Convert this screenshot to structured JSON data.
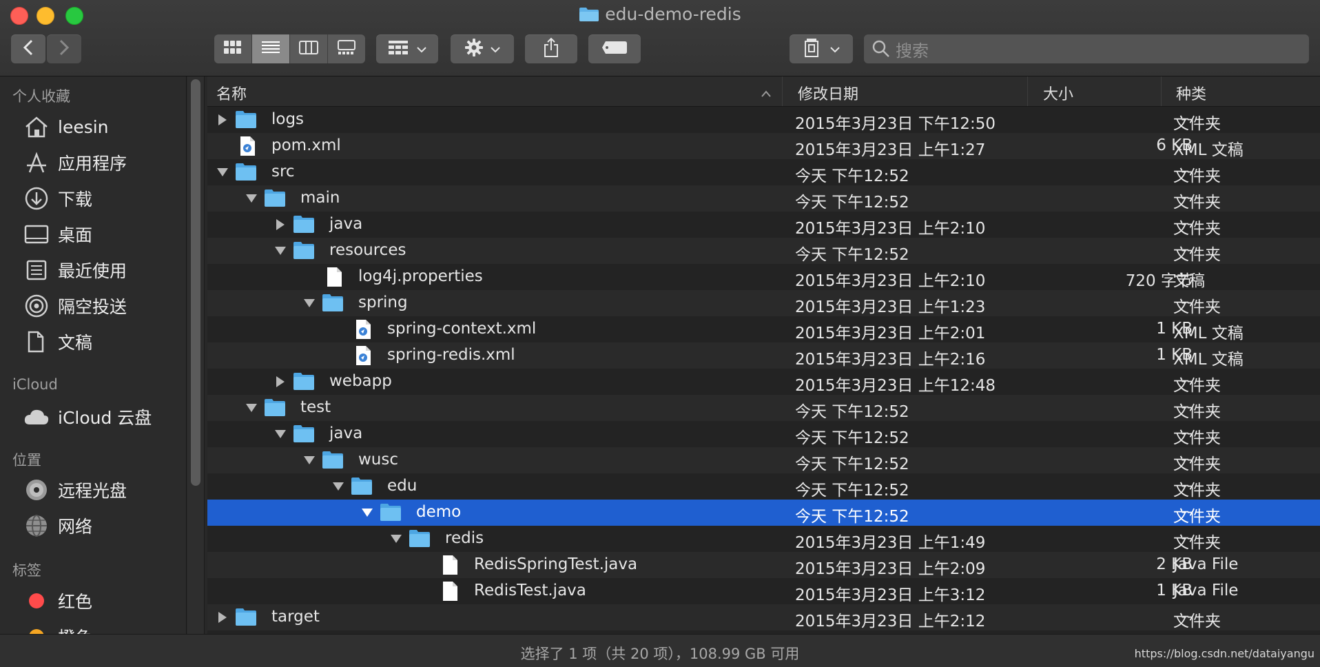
{
  "window": {
    "title": "edu-demo-redis"
  },
  "search": {
    "placeholder": "搜索"
  },
  "sidebar": {
    "sections": [
      {
        "label": "个人收藏"
      },
      {
        "label": "iCloud"
      },
      {
        "label": "位置"
      },
      {
        "label": "标签"
      }
    ],
    "favorites": [
      {
        "label": "leesin",
        "icon": "home-icon"
      },
      {
        "label": "应用程序",
        "icon": "applications-icon"
      },
      {
        "label": "下载",
        "icon": "download-icon"
      },
      {
        "label": "桌面",
        "icon": "desktop-icon"
      },
      {
        "label": "最近使用",
        "icon": "recents-icon"
      },
      {
        "label": "隔空投送",
        "icon": "airdrop-icon"
      },
      {
        "label": "文稿",
        "icon": "documents-icon"
      }
    ],
    "icloud": [
      {
        "label": "iCloud 云盘",
        "icon": "cloud-icon"
      }
    ],
    "locations": [
      {
        "label": "远程光盘",
        "icon": "disc-icon"
      },
      {
        "label": "网络",
        "icon": "network-icon"
      }
    ],
    "tags": [
      {
        "label": "红色",
        "color": "#ff4b4b"
      },
      {
        "label": "橙色",
        "color": "#f5a623"
      }
    ]
  },
  "columns": {
    "name": "名称",
    "date": "修改日期",
    "size": "大小",
    "kind": "种类"
  },
  "files": [
    {
      "name": "logs",
      "date": "2015年3月23日 下午12:50",
      "size": "--",
      "kind": "文件夹",
      "type": "folder",
      "disclosure": "collapsed",
      "depth": 0
    },
    {
      "name": "pom.xml",
      "date": "2015年3月23日 上午1:27",
      "size": "6 KB",
      "kind": "XML 文稿",
      "type": "xml",
      "disclosure": "none",
      "depth": 0
    },
    {
      "name": "src",
      "date": "今天 下午12:52",
      "size": "--",
      "kind": "文件夹",
      "type": "folder",
      "disclosure": "expanded",
      "depth": 0
    },
    {
      "name": "main",
      "date": "今天 下午12:52",
      "size": "--",
      "kind": "文件夹",
      "type": "folder",
      "disclosure": "expanded",
      "depth": 1
    },
    {
      "name": "java",
      "date": "2015年3月23日 上午2:10",
      "size": "--",
      "kind": "文件夹",
      "type": "folder",
      "disclosure": "collapsed",
      "depth": 2
    },
    {
      "name": "resources",
      "date": "今天 下午12:52",
      "size": "--",
      "kind": "文件夹",
      "type": "folder",
      "disclosure": "expanded",
      "depth": 2
    },
    {
      "name": "log4j.properties",
      "date": "2015年3月23日 上午2:10",
      "size": "720 字节",
      "kind": "文稿",
      "type": "file",
      "disclosure": "none",
      "depth": 3
    },
    {
      "name": "spring",
      "date": "2015年3月23日 上午1:23",
      "size": "--",
      "kind": "文件夹",
      "type": "folder",
      "disclosure": "expanded",
      "depth": 3
    },
    {
      "name": "spring-context.xml",
      "date": "2015年3月23日 上午2:01",
      "size": "1 KB",
      "kind": "XML 文稿",
      "type": "xml",
      "disclosure": "none",
      "depth": 4
    },
    {
      "name": "spring-redis.xml",
      "date": "2015年3月23日 上午2:16",
      "size": "1 KB",
      "kind": "XML 文稿",
      "type": "xml",
      "disclosure": "none",
      "depth": 4
    },
    {
      "name": "webapp",
      "date": "2015年3月23日 上午12:48",
      "size": "--",
      "kind": "文件夹",
      "type": "folder",
      "disclosure": "collapsed",
      "depth": 2
    },
    {
      "name": "test",
      "date": "今天 下午12:52",
      "size": "--",
      "kind": "文件夹",
      "type": "folder",
      "disclosure": "expanded",
      "depth": 1
    },
    {
      "name": "java",
      "date": "今天 下午12:52",
      "size": "--",
      "kind": "文件夹",
      "type": "folder",
      "disclosure": "expanded",
      "depth": 2
    },
    {
      "name": "wusc",
      "date": "今天 下午12:52",
      "size": "--",
      "kind": "文件夹",
      "type": "folder",
      "disclosure": "expanded",
      "depth": 3
    },
    {
      "name": "edu",
      "date": "今天 下午12:52",
      "size": "--",
      "kind": "文件夹",
      "type": "folder",
      "disclosure": "expanded",
      "depth": 4
    },
    {
      "name": "demo",
      "date": "今天 下午12:52",
      "size": "--",
      "kind": "文件夹",
      "type": "folder",
      "disclosure": "expanded",
      "depth": 5,
      "selected": true
    },
    {
      "name": "redis",
      "date": "2015年3月23日 上午1:49",
      "size": "--",
      "kind": "文件夹",
      "type": "folder",
      "disclosure": "expanded",
      "depth": 6
    },
    {
      "name": "RedisSpringTest.java",
      "date": "2015年3月23日 上午2:09",
      "size": "2 KB",
      "kind": "Java File",
      "type": "file",
      "disclosure": "none",
      "depth": 7
    },
    {
      "name": "RedisTest.java",
      "date": "2015年3月23日 上午3:12",
      "size": "1 KB",
      "kind": "Java File",
      "type": "file",
      "disclosure": "none",
      "depth": 7
    },
    {
      "name": "target",
      "date": "2015年3月23日 上午2:12",
      "size": "--",
      "kind": "文件夹",
      "type": "folder",
      "disclosure": "collapsed",
      "depth": 0
    }
  ],
  "status": {
    "text": "选择了 1 项（共 20 项），108.99 GB 可用",
    "watermark": "https://blog.csdn.net/dataiyangu"
  }
}
